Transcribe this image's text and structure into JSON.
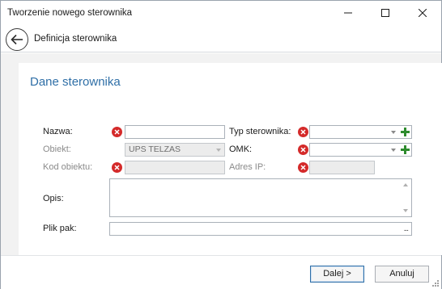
{
  "window": {
    "title": "Tworzenie nowego sterownika"
  },
  "nav": {
    "title": "Definicja sterownika"
  },
  "section": {
    "title": "Dane sterownika"
  },
  "form": {
    "nazwa": {
      "label": "Nazwa:",
      "value": ""
    },
    "obiekt": {
      "label": "Obiekt:",
      "value": "UPS TELZAS"
    },
    "kod_obiektu": {
      "label": "Kod obiektu:",
      "value": ""
    },
    "typ_sterownika": {
      "label": "Typ sterownika:",
      "value": ""
    },
    "omk": {
      "label": "OMK:",
      "value": ""
    },
    "adres_ip": {
      "label": "Adres IP:",
      "value": ""
    },
    "opis": {
      "label": "Opis:",
      "value": ""
    },
    "plik_pak": {
      "label": "Plik pak:",
      "value": "",
      "browse_label": "..."
    }
  },
  "footer": {
    "next_label": "Dalej >",
    "cancel_label": "Anuluj"
  },
  "colors": {
    "accent": "#2f6fa7",
    "error": "#d42a2a",
    "add": "#2e8b2e",
    "content_background": "#f2f2f2"
  },
  "icons": {
    "back": "arrow-left-circle-icon",
    "error": "error-x-circle-icon",
    "add": "plus-icon",
    "dropdown": "chevron-down-icon"
  }
}
